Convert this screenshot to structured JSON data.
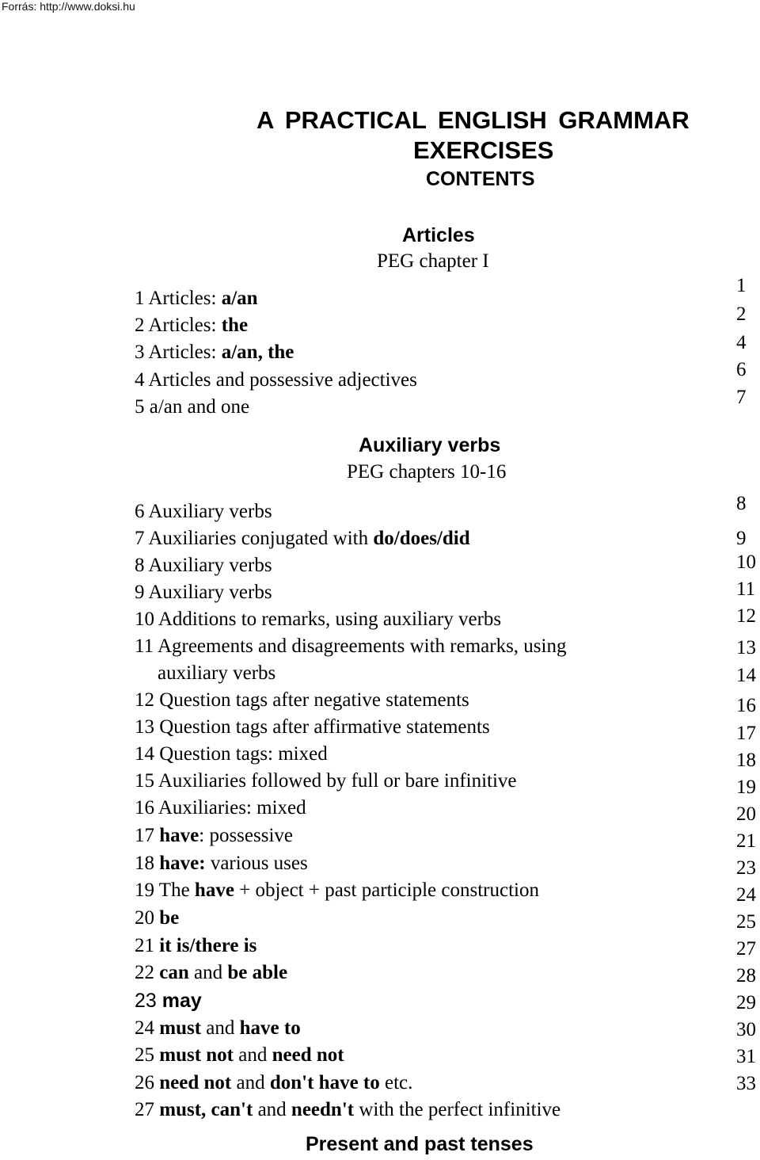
{
  "source": "Forrás: http://www.doksi.hu",
  "title": {
    "line1": "A PRACTICAL ENGLISH GRAMMAR",
    "line2": "EXERCISES",
    "line3": "CONTENTS"
  },
  "sections": [
    {
      "heading": "Articles",
      "subheading": "PEG chapter I",
      "entries": [
        {
          "num": "1",
          "parts": [
            {
              "t": " Articles: ",
              "b": false
            },
            {
              "t": "a/an",
              "b": true
            }
          ]
        },
        {
          "num": "2",
          "parts": [
            {
              "t": " Articles: ",
              "b": false
            },
            {
              "t": "the",
              "b": true
            }
          ]
        },
        {
          "num": "3",
          "parts": [
            {
              "t": " Articles: ",
              "b": false
            },
            {
              "t": "a/an, the",
              "b": true
            }
          ]
        },
        {
          "num": "4",
          "parts": [
            {
              "t": " Articles and possessive adjectives",
              "b": false
            }
          ]
        },
        {
          "num": "5",
          "parts": [
            {
              "t": " a/an and one",
              "b": false
            }
          ]
        }
      ],
      "pages": [
        "1",
        "2",
        "4",
        "6",
        "7"
      ]
    },
    {
      "heading": "Auxiliary verbs",
      "subheading": "PEG chapters 10-16",
      "entries": [
        {
          "num": "6",
          "parts": [
            {
              "t": " Auxiliary verbs",
              "b": false
            }
          ]
        },
        {
          "num": "7",
          "parts": [
            {
              "t": " Auxiliaries conjugated with ",
              "b": false
            },
            {
              "t": "do/does/did",
              "b": true
            }
          ]
        },
        {
          "num": "8",
          "parts": [
            {
              "t": " Auxiliary verbs",
              "b": false
            }
          ]
        },
        {
          "num": "9",
          "parts": [
            {
              "t": " Auxiliary verbs",
              "b": false
            }
          ]
        },
        {
          "num": "10",
          "parts": [
            {
              "t": " Additions to remarks, using auxiliary verbs",
              "b": false
            }
          ]
        },
        {
          "num": "11",
          "parts": [
            {
              "t": " Agreements and disagreements with remarks, using",
              "b": false
            }
          ],
          "continuation": "auxiliary verbs"
        },
        {
          "num": "12",
          "parts": [
            {
              "t": " Question tags after negative statements",
              "b": false
            }
          ]
        },
        {
          "num": "13",
          "parts": [
            {
              "t": " Question tags after affirmative statements",
              "b": false
            }
          ]
        },
        {
          "num": "14",
          "parts": [
            {
              "t": " Question tags: mixed",
              "b": false
            }
          ]
        },
        {
          "num": "15",
          "parts": [
            {
              "t": " Auxiliaries followed by full or bare infinitive",
              "b": false
            }
          ]
        },
        {
          "num": "16",
          "parts": [
            {
              "t": " Auxiliaries: mixed",
              "b": false
            }
          ]
        },
        {
          "num": "17",
          "parts": [
            {
              "t": " ",
              "b": false
            },
            {
              "t": "have",
              "b": true
            },
            {
              "t": ": possessive",
              "b": false
            }
          ]
        },
        {
          "num": "18",
          "parts": [
            {
              "t": " ",
              "b": false
            },
            {
              "t": "have:",
              "b": true
            },
            {
              "t": " various uses",
              "b": false
            }
          ]
        },
        {
          "num": "19",
          "parts": [
            {
              "t": " The ",
              "b": false
            },
            {
              "t": "have",
              "b": true
            },
            {
              "t": " + object + past participle construction",
              "b": false
            }
          ]
        },
        {
          "num": "20",
          "parts": [
            {
              "t": " ",
              "b": false
            },
            {
              "t": "be",
              "b": true
            }
          ]
        },
        {
          "num": "21",
          "parts": [
            {
              "t": " ",
              "b": false
            },
            {
              "t": "it is/there is",
              "b": true
            }
          ]
        },
        {
          "num": "22",
          "parts": [
            {
              "t": " ",
              "b": false
            },
            {
              "t": "can",
              "b": true
            },
            {
              "t": " and ",
              "b": false
            },
            {
              "t": "be able",
              "b": true
            }
          ]
        },
        {
          "num": "23",
          "parts": [
            {
              "t": " ",
              "b": false
            },
            {
              "t": "may",
              "b": true
            }
          ],
          "sans": true
        },
        {
          "num": "24",
          "parts": [
            {
              "t": " ",
              "b": false
            },
            {
              "t": "must",
              "b": true
            },
            {
              "t": " and ",
              "b": false
            },
            {
              "t": "have to",
              "b": true
            }
          ]
        },
        {
          "num": "25",
          "parts": [
            {
              "t": " ",
              "b": false
            },
            {
              "t": "must not",
              "b": true
            },
            {
              "t": " and ",
              "b": false
            },
            {
              "t": "need not",
              "b": true
            }
          ]
        },
        {
          "num": "26",
          "parts": [
            {
              "t": " ",
              "b": false
            },
            {
              "t": "need not",
              "b": true
            },
            {
              "t": " and ",
              "b": false
            },
            {
              "t": "don't have to",
              "b": true
            },
            {
              "t": " etc.",
              "b": false
            }
          ]
        },
        {
          "num": "27",
          "parts": [
            {
              "t": " ",
              "b": false
            },
            {
              "t": "must, can't",
              "b": true
            },
            {
              "t": " and ",
              "b": false
            },
            {
              "t": "needn't",
              "b": true
            },
            {
              "t": " with the perfect infinitive",
              "b": false
            }
          ]
        }
      ],
      "pages": [
        "8",
        "9",
        "10",
        "11",
        "12",
        "13",
        "14",
        "16",
        "17",
        "18",
        "19",
        "20",
        "21",
        "23",
        "24",
        "25",
        "27",
        "28",
        "29",
        "30",
        "31",
        "33"
      ]
    },
    {
      "heading": "Present and past tenses"
    }
  ]
}
